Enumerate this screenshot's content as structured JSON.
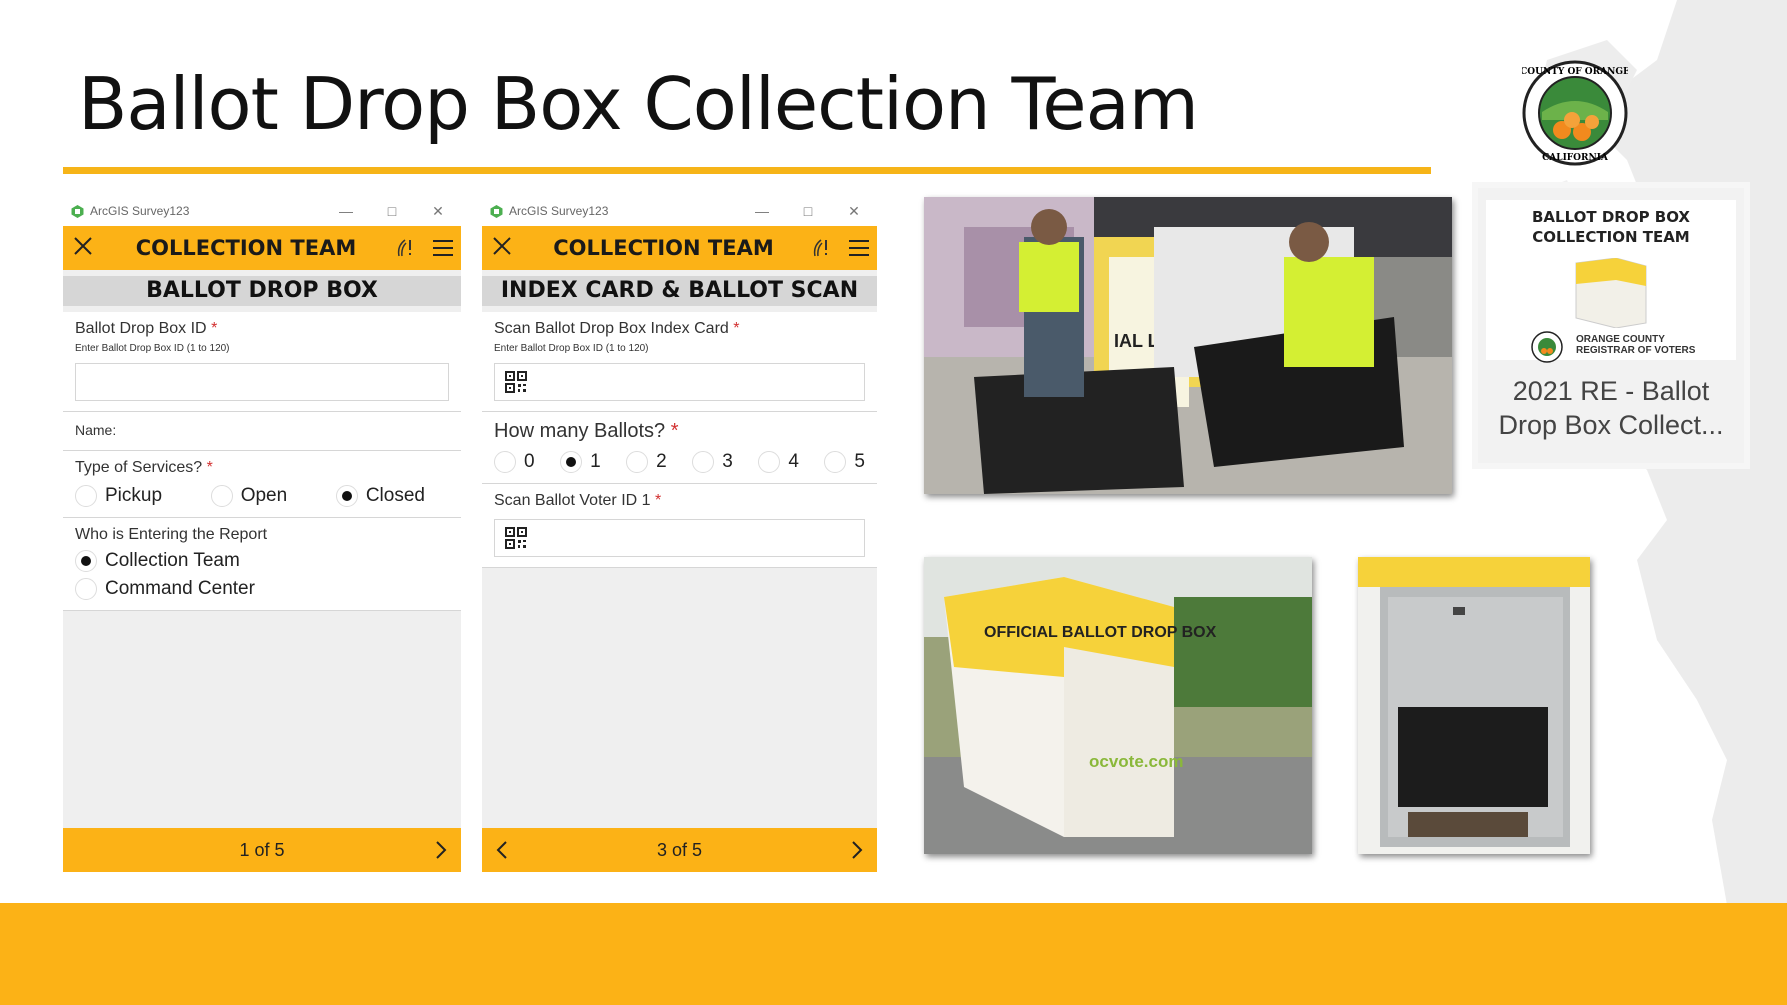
{
  "slide": {
    "title": "Ballot Drop Box Collection Team"
  },
  "colors": {
    "accent": "#fcb216",
    "heading_band": "#d6d6d6",
    "required": "#d23030"
  },
  "window": {
    "app_name": "ArcGIS Survey123",
    "minimize_icon": "minimize-icon",
    "maximize_icon": "maximize-icon",
    "close_icon": "close-icon"
  },
  "phone1": {
    "header_title": "COLLECTION TEAM",
    "form_heading": "BALLOT DROP BOX",
    "fields": {
      "box_id_label": "Ballot Drop Box ID",
      "box_id_hint": "Enter Ballot Drop Box ID (1 to 120)",
      "box_id_value": "",
      "name_label": "Name:",
      "services_label": "Type of Services?",
      "services_options": [
        "Pickup",
        "Open",
        "Closed"
      ],
      "services_selected": "Closed",
      "entering_label": "Who is Entering the Report",
      "entering_options": [
        "Collection Team",
        "Command Center"
      ],
      "entering_selected": "Collection Team"
    },
    "page_indicator": "1 of 5"
  },
  "phone2": {
    "header_title": "COLLECTION TEAM",
    "form_heading": "INDEX CARD & BALLOT SCAN",
    "fields": {
      "scan_card_label": "Scan Ballot Drop Box Index Card",
      "scan_card_hint": "Enter Ballot Drop Box ID (1 to 120)",
      "ballots_label": "How many Ballots?",
      "ballot_options": [
        "0",
        "1",
        "2",
        "3",
        "4",
        "5"
      ],
      "ballots_selected": "1",
      "scan_voter_label": "Scan Ballot Voter ID 1"
    },
    "page_indicator": "3 of 5"
  },
  "required_marker": "*",
  "card": {
    "banner_line1": "BALLOT DROP BOX",
    "banner_line2": "COLLECTION TEAM",
    "org_line1": "ORANGE COUNTY",
    "org_line2": "REGISTRAR OF VOTERS",
    "caption_line1": "2021 RE - Ballot",
    "caption_line2": "Drop Box Collect..."
  },
  "seal": {
    "top_text": "COUNTY OF ORANGE",
    "bottom_text": "CALIFORNIA"
  },
  "photos": {
    "photo1_box_text": "IAL LOT BOX",
    "photo2_box_text1": "OFFICIAL BALLOT DROP BOX",
    "photo2_url_text": "ocvote.com"
  }
}
